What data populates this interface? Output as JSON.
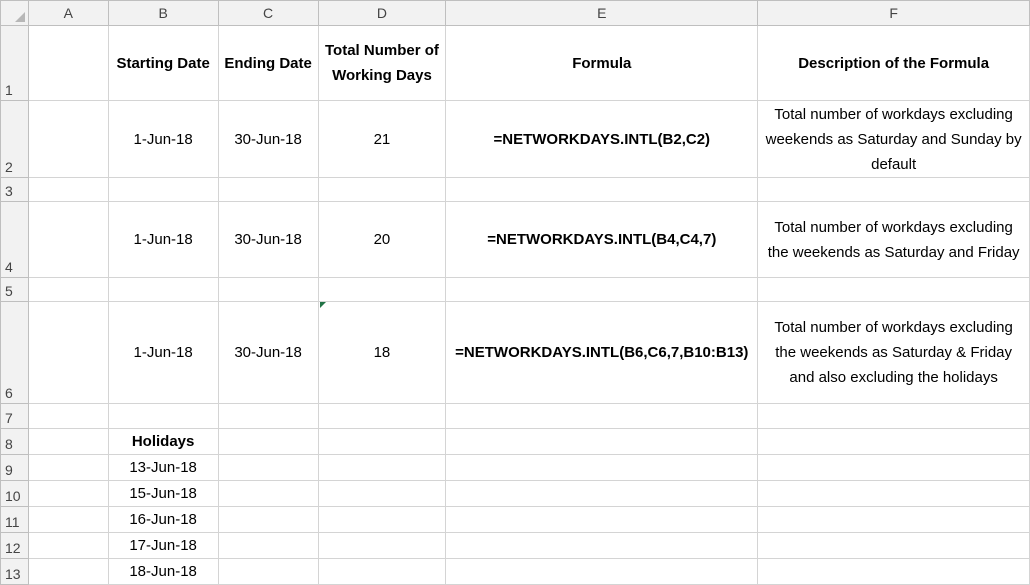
{
  "columns": [
    "A",
    "B",
    "C",
    "D",
    "E",
    "F"
  ],
  "rows": [
    "1",
    "2",
    "3",
    "4",
    "5",
    "6",
    "7",
    "8",
    "9",
    "10",
    "11",
    "12",
    "13"
  ],
  "headers": {
    "starting_date": "Starting Date",
    "ending_date": "Ending Date",
    "total_working_days": "Total Number of Working Days",
    "formula": "Formula",
    "description": "Description of the Formula"
  },
  "records": [
    {
      "start": "1-Jun-18",
      "end": "30-Jun-18",
      "days": "21",
      "formula": "=NETWORKDAYS.INTL(B2,C2)",
      "description": "Total number of workdays excluding weekends as Saturday and Sunday by default"
    },
    {
      "start": "1-Jun-18",
      "end": "30-Jun-18",
      "days": "20",
      "formula": "=NETWORKDAYS.INTL(B4,C4,7)",
      "description": "Total number of workdays excluding the weekends as Saturday and Friday"
    },
    {
      "start": "1-Jun-18",
      "end": "30-Jun-18",
      "days": "18",
      "formula": "=NETWORKDAYS.INTL(B6,C6,7,B10:B13)",
      "description": "Total number of workdays excluding the weekends as Saturday & Friday and also excluding the holidays"
    }
  ],
  "holidays_label": "Holidays",
  "holidays": [
    "13-Jun-18",
    "15-Jun-18",
    "16-Jun-18",
    "17-Jun-18",
    "18-Jun-18"
  ]
}
